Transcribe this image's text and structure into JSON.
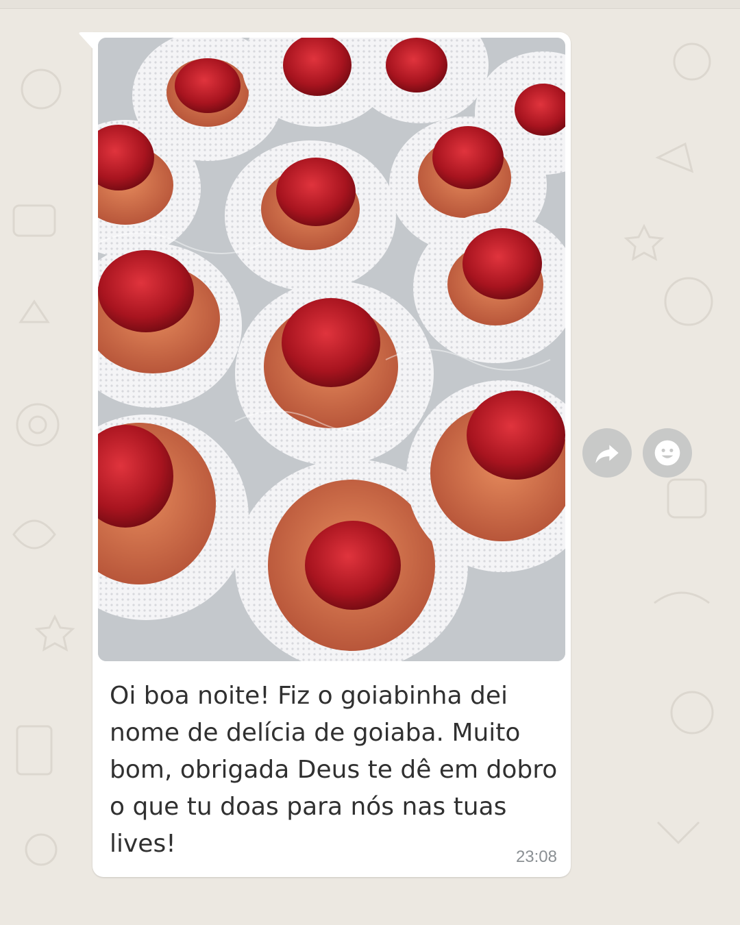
{
  "message": {
    "photo_alt": "goiabinha",
    "caption": "Oi boa noite! Fiz o goiabinha dei\nnome de delícia de goiaba. Muito\nbom, obrigada Deus te dê em dobro\no que tu doas para nós nas tuas\nlives!",
    "time": "23:08"
  },
  "actions": {
    "forward_icon": "forward-arrow-icon",
    "react_icon": "smiley-icon"
  },
  "colors": {
    "background": "#ece8e1",
    "bubble": "#ffffff",
    "action_button": "#c8c9c8",
    "text": "#303030",
    "timestamp": "#8a8f93"
  }
}
